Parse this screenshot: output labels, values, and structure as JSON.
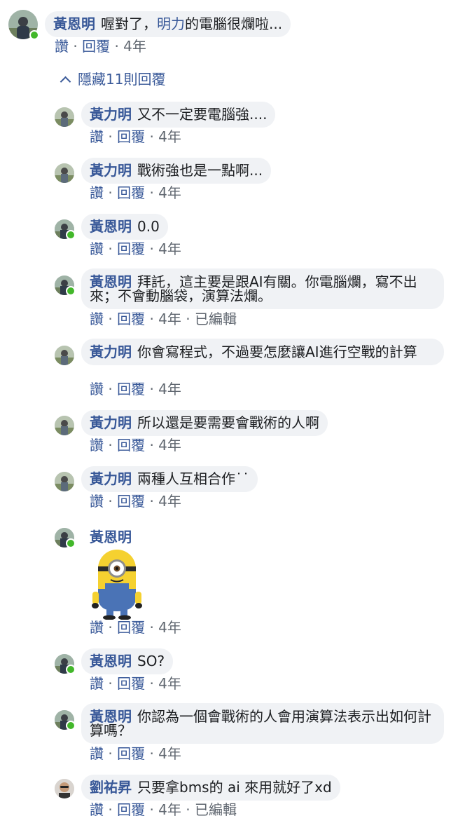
{
  "root": {
    "name": "黃恩明",
    "text_before": "喔對了，",
    "mention": "明力",
    "text_after": "的電腦很爛啦...",
    "like": "讚",
    "reply": "回覆",
    "time": "4年"
  },
  "hide_replies": "隱藏11則回覆",
  "sep": "·",
  "replies": [
    {
      "name": "黃力明",
      "text": "又不一定要電腦強....",
      "like": "讚",
      "reply": "回覆",
      "time": "4年"
    },
    {
      "name": "黃力明",
      "text": "戰術強也是一點啊...",
      "like": "讚",
      "reply": "回覆",
      "time": "4年"
    },
    {
      "name": "黃恩明",
      "text": "0.0",
      "like": "讚",
      "reply": "回覆",
      "time": "4年"
    },
    {
      "name": "黃恩明",
      "text": "拜託，這主要是跟AI有關。你電腦爛，寫不出來；不會動腦袋，演算法爛。",
      "like": "讚",
      "reply": "回覆",
      "time": "4年",
      "edited": "已編輯"
    },
    {
      "name": "黃力明",
      "text": "你會寫程式，不過要怎麼讓AI進行空戰的計算",
      "like": "讚",
      "reply": "回覆",
      "time": "4年"
    },
    {
      "name": "黃力明",
      "text": "所以還是要需要會戰術的人啊",
      "like": "讚",
      "reply": "回覆",
      "time": "4年"
    },
    {
      "name": "黃力明",
      "text": "兩種人互相合作˙˙",
      "like": "讚",
      "reply": "回覆",
      "time": "4年"
    },
    {
      "name": "黃恩明",
      "like": "讚",
      "reply": "回覆",
      "time": "4年",
      "sticker": "minion-sticker"
    },
    {
      "name": "黃恩明",
      "text": "SO?",
      "like": "讚",
      "reply": "回覆",
      "time": "4年"
    },
    {
      "name": "黃恩明",
      "text": "你認為一個會戰術的人會用演算法表示出如何計算嗎？",
      "like": "讚",
      "reply": "回覆",
      "time": "4年"
    },
    {
      "name": "劉祐昇",
      "text": "只要拿bms的 ai 來用就好了xd",
      "like": "讚",
      "reply": "回覆",
      "time": "4年",
      "edited": "已編輯"
    }
  ],
  "colors": {
    "link": "#385898",
    "bubble": "#f0f2f5",
    "online": "#42b72a",
    "muted": "#606770"
  }
}
